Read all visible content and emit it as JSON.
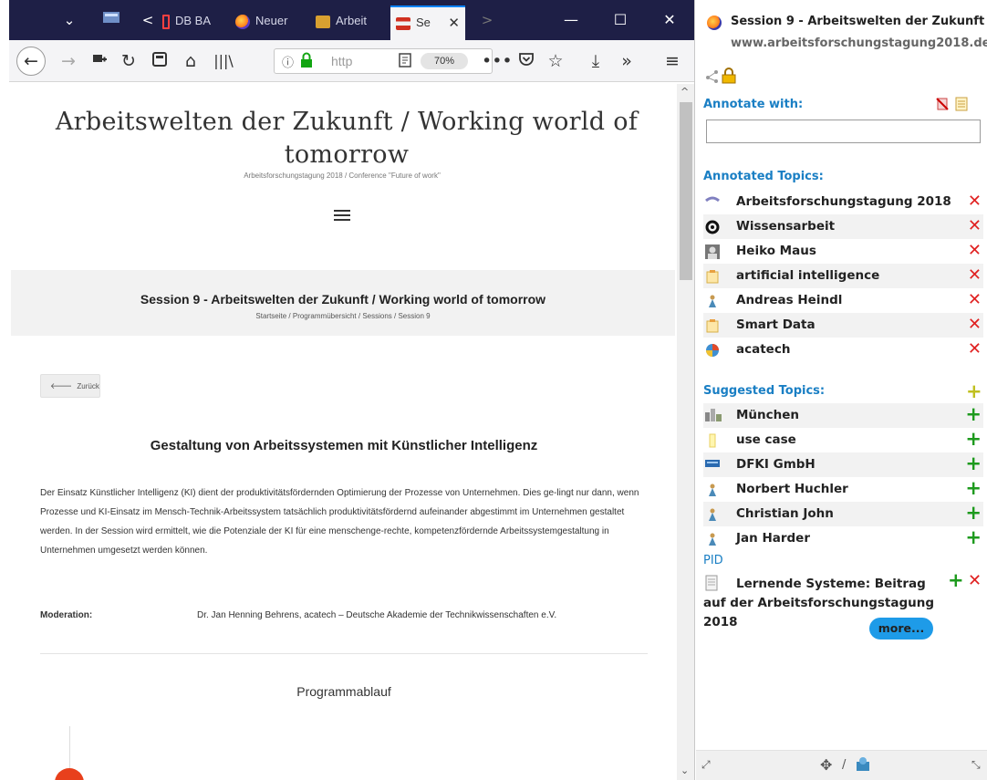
{
  "browser": {
    "tabs": [
      {
        "label": "DB BA"
      },
      {
        "label": "Neuer"
      },
      {
        "label": "Arbeit"
      },
      {
        "label": "Se"
      }
    ],
    "url_text": "http",
    "zoom": "70%"
  },
  "page": {
    "site_title": "Arbeitswelten der Zukunft / Working world of tomorrow",
    "site_subtitle": "Arbeitsforschungstagung 2018 / Conference \"Future of work\"",
    "session_title": "Session 9 - Arbeitswelten der Zukunft / Working world of tomorrow",
    "breadcrumb": "Startseite / Programmübersicht / Sessions / Session 9",
    "back_label": "Zurück",
    "article_heading": "Gestaltung von Arbeitssystemen mit Künstlicher Intelligenz",
    "article_body": "Der Einsatz Künstlicher Intelligenz (KI) dient der produktivitätsfördernden Optimierung der Prozesse von Unternehmen. Dies ge-lingt nur dann, wenn Prozesse und KI-Einsatz im Mensch-Technik-Arbeitssystem tatsächlich produktivitätsfördernd aufeinander abgestimmt im Unternehmen gestaltet werden. In der Session wird ermittelt, wie die Potenziale der KI für eine menschenge-rechte, kompetenzfördernde Arbeitssystemgestaltung in Unternehmen umgesetzt werden können.",
    "moderation_label": "Moderation:",
    "moderation_value": "Dr. Jan Henning Behrens, acatech – Deutsche Akademie der Technikwissenschaften e.V.",
    "program_heading": "Programmablauf"
  },
  "sidebar": {
    "title": "Session 9 - Arbeitswelten der Zukunft",
    "url": "www.arbeitsforschungstagung2018.de",
    "annotate_label": "Annotate with:",
    "annotated_label": "Annotated Topics:",
    "annotated": [
      {
        "label": "Arbeitsforschungstagung 2018",
        "icon": "event-icon"
      },
      {
        "label": "Wissensarbeit",
        "icon": "concept-icon"
      },
      {
        "label": "Heiko Maus",
        "icon": "person-photo-icon"
      },
      {
        "label": "artificial intelligence",
        "icon": "topic-folder-icon"
      },
      {
        "label": "Andreas Heindl",
        "icon": "person-icon"
      },
      {
        "label": "Smart Data",
        "icon": "topic-folder-icon"
      },
      {
        "label": "acatech",
        "icon": "organization-icon"
      }
    ],
    "suggested_label": "Suggested Topics:",
    "suggested": [
      {
        "label": "München",
        "icon": "location-icon"
      },
      {
        "label": "use case",
        "icon": "note-icon"
      },
      {
        "label": "DFKI GmbH",
        "icon": "company-icon"
      },
      {
        "label": "Norbert Huchler",
        "icon": "person-icon"
      },
      {
        "label": "Christian John",
        "icon": "person-icon"
      },
      {
        "label": "Jan Harder",
        "icon": "person-icon"
      }
    ],
    "pid_label": "PID",
    "pid_item": "Lernende Systeme: Beitrag auf der Arbeitsforschungstagung 2018",
    "more_label": "more...",
    "footer_sep": "/"
  }
}
